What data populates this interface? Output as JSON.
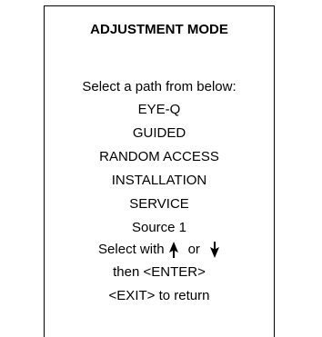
{
  "menu": {
    "title": "ADJUSTMENT MODE",
    "prompt": "Select a path from below:",
    "items": [
      {
        "label": "EYE-Q"
      },
      {
        "label": "GUIDED"
      },
      {
        "label": "RANDOM ACCESS"
      },
      {
        "label": "INSTALLATION"
      },
      {
        "label": "SERVICE"
      }
    ],
    "source": "Source 1",
    "select_prefix": "Select with",
    "select_or": "or",
    "enter_hint": "then <ENTER>",
    "exit_hint": "<EXIT> to return"
  },
  "icons": {
    "up": "arrow-up-icon",
    "down": "arrow-down-icon"
  }
}
